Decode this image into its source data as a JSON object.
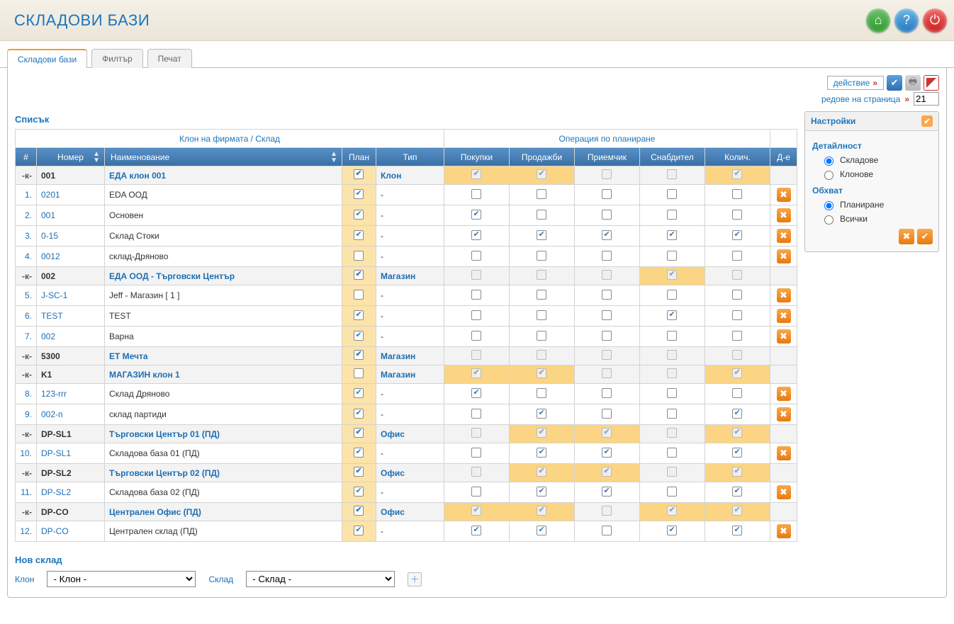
{
  "title": "СКЛАДОВИ БАЗИ",
  "tabs": [
    "Складови бази",
    "Филтър",
    "Печат"
  ],
  "active_tab": 0,
  "toolbar": {
    "action_label": "действие",
    "rows_label": "редове на страница",
    "rows_value": "21"
  },
  "list_header": "Списък",
  "grid": {
    "group_headers": [
      "Клон на фирмата / Склад",
      "Операция по планиране"
    ],
    "cols": [
      "#",
      "Номер",
      "Наименование",
      "План",
      "Тип",
      "Покупки",
      "Продажби",
      "Приемчик",
      "Снабдител",
      "Колич.",
      "Д-е"
    ],
    "rows": [
      {
        "klon": true,
        "idx": "-к-",
        "num": "001",
        "name": "ЕДА клон 001",
        "plan": true,
        "type": "Клон",
        "buy": {
          "c": true,
          "d": true,
          "h": true
        },
        "sell": {
          "c": true,
          "d": true,
          "h": true
        },
        "recv": {
          "c": false,
          "d": true
        },
        "supp": {
          "c": false,
          "d": true
        },
        "qty": {
          "c": true,
          "d": true,
          "h": true
        },
        "del": false
      },
      {
        "idx": "1.",
        "num": "0201",
        "name": "EDA ООД",
        "plan": true,
        "type": "-",
        "buy": {
          "c": false
        },
        "sell": {
          "c": false
        },
        "recv": {
          "c": false
        },
        "supp": {
          "c": false
        },
        "qty": {
          "c": false
        },
        "del": true
      },
      {
        "idx": "2.",
        "num": "001",
        "name": "Основен",
        "plan": true,
        "type": "-",
        "buy": {
          "c": true
        },
        "sell": {
          "c": false
        },
        "recv": {
          "c": false
        },
        "supp": {
          "c": false
        },
        "qty": {
          "c": false
        },
        "del": true
      },
      {
        "idx": "3.",
        "num": "0-15",
        "name": "Склад Стоки",
        "plan": true,
        "type": "-",
        "buy": {
          "c": true
        },
        "sell": {
          "c": true
        },
        "recv": {
          "c": true
        },
        "supp": {
          "c": true
        },
        "qty": {
          "c": true
        },
        "del": true
      },
      {
        "idx": "4.",
        "num": "0012",
        "name": "склад-Дряново",
        "plan": false,
        "type": "-",
        "buy": {
          "c": false
        },
        "sell": {
          "c": false
        },
        "recv": {
          "c": false
        },
        "supp": {
          "c": false
        },
        "qty": {
          "c": false
        },
        "del": true
      },
      {
        "klon": true,
        "idx": "-к-",
        "num": "002",
        "name": "ЕДА ООД - Търговски Център",
        "plan": true,
        "type": "Магазин",
        "buy": {
          "c": false,
          "d": true
        },
        "sell": {
          "c": false,
          "d": true
        },
        "recv": {
          "c": false,
          "d": true
        },
        "supp": {
          "c": true,
          "d": true,
          "h": true
        },
        "qty": {
          "c": false,
          "d": true
        },
        "del": false
      },
      {
        "idx": "5.",
        "num": "J-SC-1",
        "name": "Jeff - Магазин [ 1 ]",
        "plan": false,
        "type": "-",
        "buy": {
          "c": false
        },
        "sell": {
          "c": false
        },
        "recv": {
          "c": false
        },
        "supp": {
          "c": false
        },
        "qty": {
          "c": false
        },
        "del": true
      },
      {
        "idx": "6.",
        "num": "TEST",
        "name": "TEST",
        "plan": true,
        "type": "-",
        "buy": {
          "c": false
        },
        "sell": {
          "c": false
        },
        "recv": {
          "c": false
        },
        "supp": {
          "c": true
        },
        "qty": {
          "c": false
        },
        "del": true
      },
      {
        "idx": "7.",
        "num": "002",
        "name": "Варна",
        "plan": true,
        "type": "-",
        "buy": {
          "c": false
        },
        "sell": {
          "c": false
        },
        "recv": {
          "c": false
        },
        "supp": {
          "c": false
        },
        "qty": {
          "c": false
        },
        "del": true
      },
      {
        "klon": true,
        "idx": "-к-",
        "num": "5300",
        "name": "ЕТ Мечта",
        "plan": true,
        "type": "Магазин",
        "buy": {
          "c": false,
          "d": true
        },
        "sell": {
          "c": false,
          "d": true
        },
        "recv": {
          "c": false,
          "d": true
        },
        "supp": {
          "c": false,
          "d": true
        },
        "qty": {
          "c": false,
          "d": true
        },
        "del": false
      },
      {
        "klon": true,
        "idx": "-к-",
        "num": "K1",
        "name": "МАГАЗИН клон 1",
        "plan": false,
        "type": "Магазин",
        "buy": {
          "c": true,
          "d": true,
          "h": true
        },
        "sell": {
          "c": true,
          "d": true,
          "h": true
        },
        "recv": {
          "c": false,
          "d": true
        },
        "supp": {
          "c": false,
          "d": true
        },
        "qty": {
          "c": true,
          "d": true,
          "h": true
        },
        "del": false
      },
      {
        "idx": "8.",
        "num": "123-rrr",
        "name": "Склад Дряново",
        "plan": true,
        "type": "-",
        "buy": {
          "c": true
        },
        "sell": {
          "c": false
        },
        "recv": {
          "c": false
        },
        "supp": {
          "c": false
        },
        "qty": {
          "c": false
        },
        "del": true
      },
      {
        "idx": "9.",
        "num": "002-п",
        "name": "склад партиди",
        "plan": true,
        "type": "-",
        "buy": {
          "c": false
        },
        "sell": {
          "c": true
        },
        "recv": {
          "c": false
        },
        "supp": {
          "c": false
        },
        "qty": {
          "c": true
        },
        "del": true
      },
      {
        "klon": true,
        "idx": "-к-",
        "num": "DP-SL1",
        "name": "Търговски Център 01 (ПД)",
        "plan": true,
        "type": "Офис",
        "buy": {
          "c": false,
          "d": true
        },
        "sell": {
          "c": true,
          "d": true,
          "h": true
        },
        "recv": {
          "c": true,
          "d": true,
          "h": true
        },
        "supp": {
          "c": false,
          "d": true
        },
        "qty": {
          "c": true,
          "d": true,
          "h": true
        },
        "del": false
      },
      {
        "idx": "10.",
        "num": "DP-SL1",
        "name": "Складова база 01 (ПД)",
        "plan": true,
        "type": "-",
        "buy": {
          "c": false
        },
        "sell": {
          "c": true
        },
        "recv": {
          "c": true
        },
        "supp": {
          "c": false
        },
        "qty": {
          "c": true
        },
        "del": true
      },
      {
        "klon": true,
        "idx": "-к-",
        "num": "DP-SL2",
        "name": "Търговски Център 02 (ПД)",
        "plan": true,
        "type": "Офис",
        "buy": {
          "c": false,
          "d": true
        },
        "sell": {
          "c": true,
          "d": true,
          "h": true
        },
        "recv": {
          "c": true,
          "d": true,
          "h": true
        },
        "supp": {
          "c": false,
          "d": true
        },
        "qty": {
          "c": true,
          "d": true,
          "h": true
        },
        "del": false
      },
      {
        "idx": "11.",
        "num": "DP-SL2",
        "name": "Складова база 02 (ПД)",
        "plan": true,
        "type": "-",
        "buy": {
          "c": false
        },
        "sell": {
          "c": true
        },
        "recv": {
          "c": true
        },
        "supp": {
          "c": false
        },
        "qty": {
          "c": true
        },
        "del": true
      },
      {
        "klon": true,
        "idx": "-к-",
        "num": "DP-CO",
        "name": "Централен Офис (ПД)",
        "plan": true,
        "type": "Офис",
        "buy": {
          "c": true,
          "d": true,
          "h": true
        },
        "sell": {
          "c": true,
          "d": true,
          "h": true
        },
        "recv": {
          "c": false,
          "d": true
        },
        "supp": {
          "c": true,
          "d": true,
          "h": true
        },
        "qty": {
          "c": true,
          "d": true,
          "h": true
        },
        "del": false
      },
      {
        "idx": "12.",
        "num": "DP-CO",
        "name": "Централен склад (ПД)",
        "plan": true,
        "type": "-",
        "buy": {
          "c": true
        },
        "sell": {
          "c": true
        },
        "recv": {
          "c": false
        },
        "supp": {
          "c": true
        },
        "qty": {
          "c": true
        },
        "del": true
      }
    ]
  },
  "new_section": {
    "title": "Нов склад",
    "klon_lbl": "Клон",
    "klon_val": "- Клон -",
    "sklad_lbl": "Склад",
    "sklad_val": "- Склад -"
  },
  "side": {
    "title": "Настройки",
    "detail_title": "Детайлност",
    "detail_opts": [
      "Складове",
      "Клонове"
    ],
    "scope_title": "Обхват",
    "scope_opts": [
      "Планиране",
      "Всички"
    ]
  }
}
